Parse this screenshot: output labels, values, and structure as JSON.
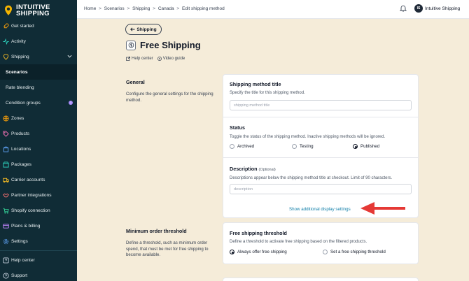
{
  "brand": {
    "name_line1": "INTUITIVE",
    "name_line2": "SHIPPING"
  },
  "sidebar": {
    "items": [
      {
        "label": "Get started",
        "icon": "rocket-icon"
      },
      {
        "label": "Activity",
        "icon": "activity-icon"
      },
      {
        "label": "Shipping",
        "icon": "pin-icon"
      },
      {
        "label": "Scenarios"
      },
      {
        "label": "Rate blending"
      },
      {
        "label": "Condition groups",
        "badge": "1"
      },
      {
        "label": "Zones",
        "icon": "globe-icon"
      },
      {
        "label": "Products",
        "icon": "tag-icon"
      },
      {
        "label": "Locations",
        "icon": "building-icon"
      },
      {
        "label": "Packages",
        "icon": "box-icon"
      },
      {
        "label": "Carrier accounts",
        "icon": "truck-icon"
      },
      {
        "label": "Partner integrations",
        "icon": "handshake-icon"
      },
      {
        "label": "Shopify connection",
        "icon": "cart-icon"
      },
      {
        "label": "Plans & billing",
        "icon": "card-icon"
      },
      {
        "label": "Settings",
        "icon": "gear-icon"
      },
      {
        "label": "Help center",
        "icon": "help-icon"
      },
      {
        "label": "Support",
        "icon": "support-icon"
      }
    ]
  },
  "topbar": {
    "breadcrumbs": [
      "Home",
      "Scenarios",
      "Shipping",
      "Canada",
      "Edit shipping method"
    ],
    "separator": ">",
    "user_initials": "IS",
    "user_name": "Intuitive Shipping"
  },
  "header": {
    "back_label": "Shipping",
    "title": "Free Shipping",
    "help_link": "Help center",
    "video_link": "Video guide"
  },
  "general": {
    "title": "General",
    "description": "Configure the general settings for the shipping method.",
    "method_title": {
      "label": "Shipping method title",
      "help": "Specify the title for this shipping method.",
      "placeholder": "shipping method title",
      "value": ""
    },
    "status": {
      "label": "Status",
      "help": "Toggle the status of the shipping method. Inactive shipping methods will be ignored.",
      "options": [
        "Archived",
        "Testing",
        "Published"
      ],
      "selected": "Published"
    },
    "description_field": {
      "label": "Description",
      "optional": "(Optional)",
      "help": "Descriptions appear below the shipping method title at checkout. Limit of 90 characters.",
      "placeholder": "description",
      "value": ""
    },
    "show_more": "Show additional display settings"
  },
  "minimum_order": {
    "title": "Minimum order threshold",
    "description": "Define a threshold, such as minimum order spend, that must be met for free shipping to become available.",
    "threshold": {
      "label": "Free shipping threshold",
      "help": "Define a threshold to activate free shipping based on the filtered products.",
      "options": [
        "Always offer free shipping",
        "Set a free shipping threshold"
      ],
      "selected": "Always offer free shipping"
    }
  },
  "colors": {
    "sidebar_bg": "#102c36",
    "page_bg": "#f5ecd9",
    "link": "#0f7ea8",
    "annotation_arrow": "#e53935"
  }
}
